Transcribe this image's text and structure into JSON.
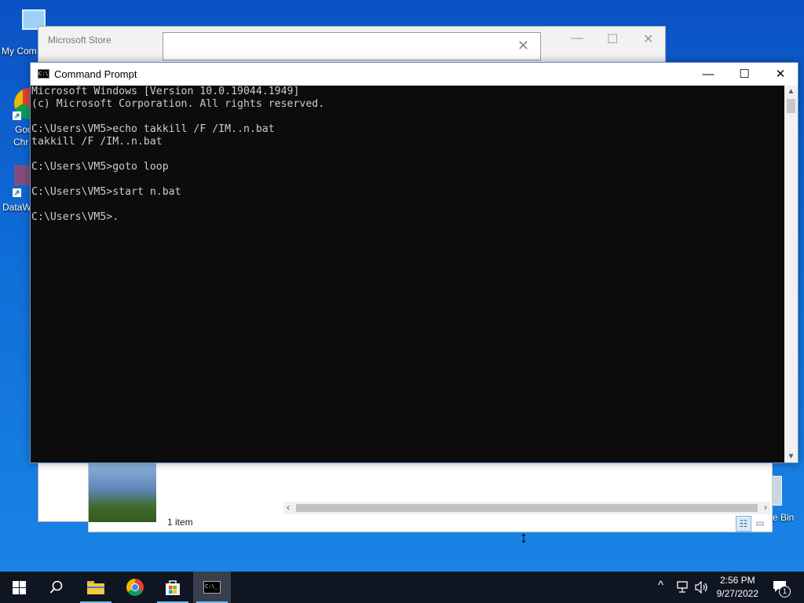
{
  "desktop": {
    "icons": [
      {
        "label": "My Com"
      },
      {
        "label": "Goc"
      },
      {
        "label": "Chr"
      },
      {
        "label": "DataW"
      },
      {
        "label": "e Bin"
      }
    ]
  },
  "store_window": {
    "title": "Microsoft Store",
    "search_value": "",
    "close_search_glyph": "✕",
    "minimize_glyph": "—",
    "maximize_glyph": "☐",
    "close_glyph": "✕"
  },
  "explorer_window": {
    "status_count": "1 item"
  },
  "cmd_window": {
    "title": "Command Prompt",
    "minimize_glyph": "—",
    "maximize_glyph": "☐",
    "close_glyph": "✕",
    "console_text": "Microsoft Windows [Version 10.0.19044.1949]\n(c) Microsoft Corporation. All rights reserved.\n\nC:\\Users\\VM5>echo takkill /F /IM..n.bat\ntakkill /F /IM..n.bat\n\nC:\\Users\\VM5>goto loop\n\nC:\\Users\\VM5>start n.bat\n\nC:\\Users\\VM5>."
  },
  "taskbar": {
    "buttons": [
      {
        "name": "start",
        "icon": "windows-logo-icon"
      },
      {
        "name": "search",
        "icon": "search-icon"
      },
      {
        "name": "file-explorer",
        "icon": "folder-icon"
      },
      {
        "name": "chrome",
        "icon": "chrome-icon"
      },
      {
        "name": "store",
        "icon": "store-bag-icon"
      },
      {
        "name": "command-prompt",
        "icon": "cmd-icon",
        "active": true
      }
    ],
    "clock": {
      "time": "2:56 PM",
      "date": "9/27/2022"
    },
    "notification_count": "1"
  },
  "colors": {
    "desktop_blue": "#0f6fd8",
    "console_bg": "#0c0c0c",
    "console_fg": "#cccccc",
    "taskbar_bg": "#101522",
    "accent": "#76b9ed"
  }
}
